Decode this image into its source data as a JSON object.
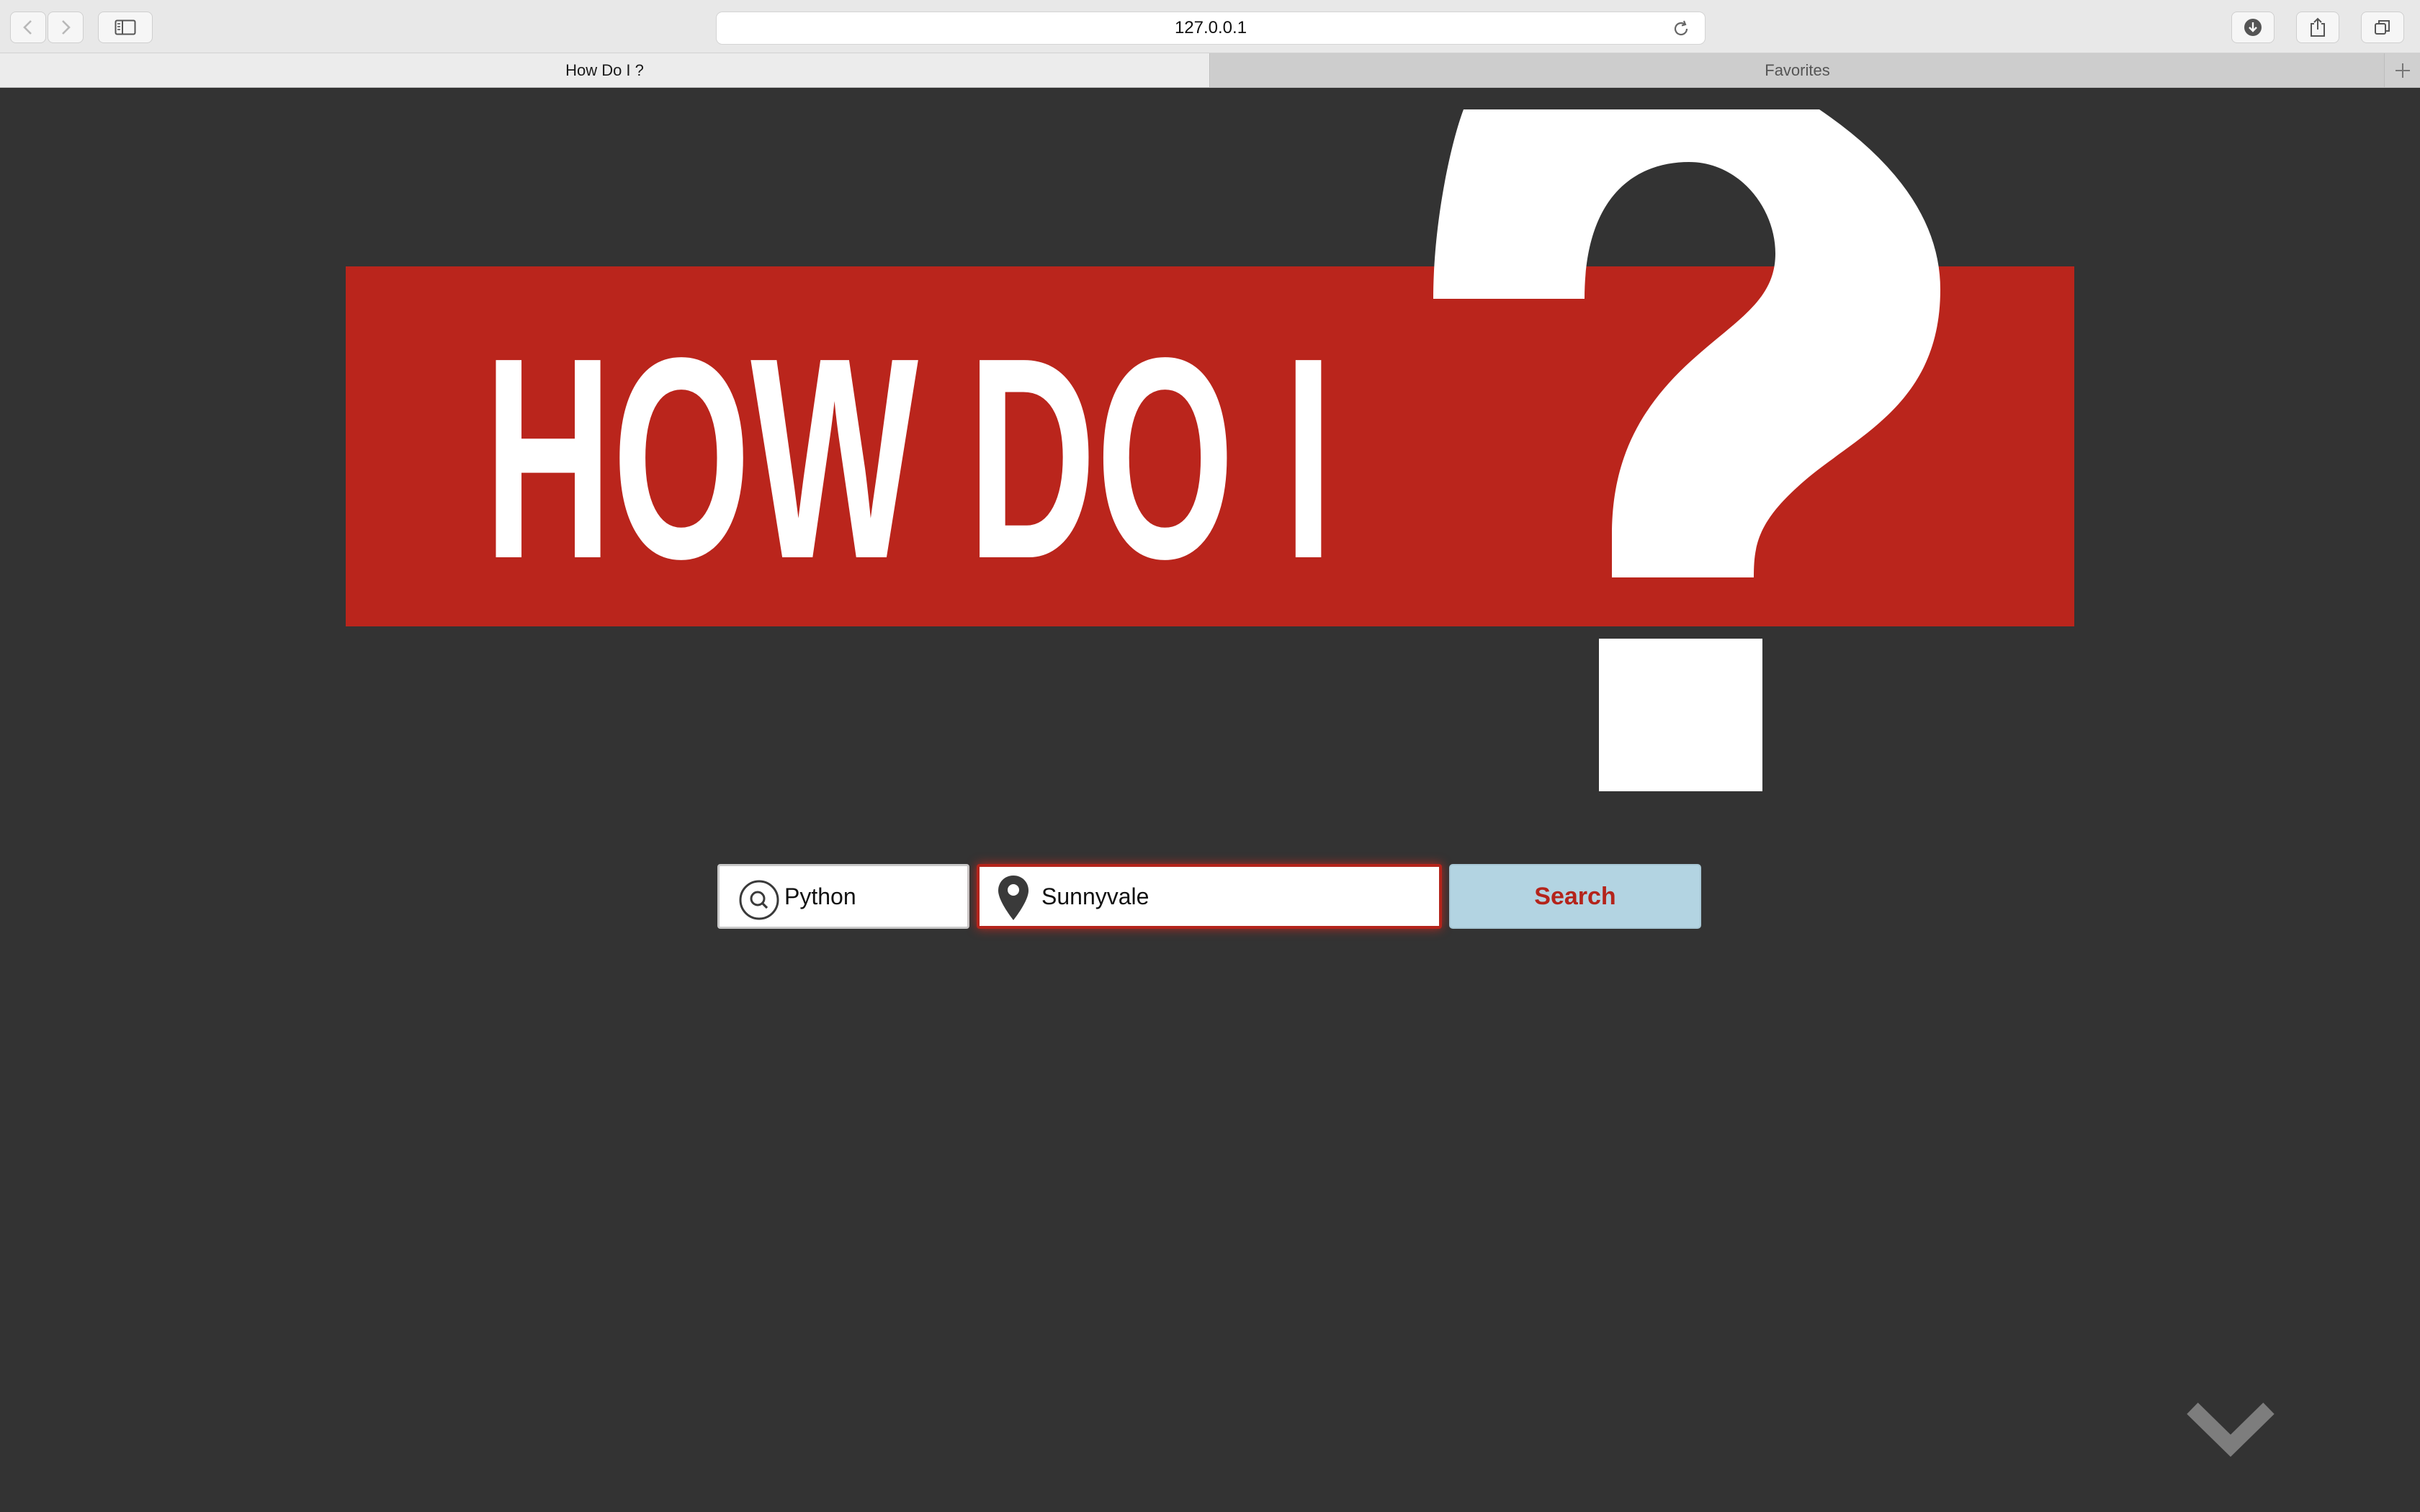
{
  "browser": {
    "url": "127.0.0.1",
    "tabs": [
      {
        "label": "How Do I ?",
        "active": true
      },
      {
        "label": "Favorites",
        "active": false
      }
    ]
  },
  "hero": {
    "logo_text": "HOW DO I",
    "logo_mark": "?",
    "colors": {
      "banner": "#ba251c",
      "text": "#ffffff",
      "background": "#333333"
    }
  },
  "search": {
    "topic_icon": "search-icon",
    "topic_value": "Python",
    "location_icon": "map-pin-icon",
    "location_value": "Sunnyvale",
    "button_label": "Search",
    "colors": {
      "button_bg": "#b3d4e2",
      "button_text": "#b4241b",
      "focus_border": "#b4241b"
    }
  },
  "footer": {
    "scroll_icon": "chevron-down-icon"
  }
}
